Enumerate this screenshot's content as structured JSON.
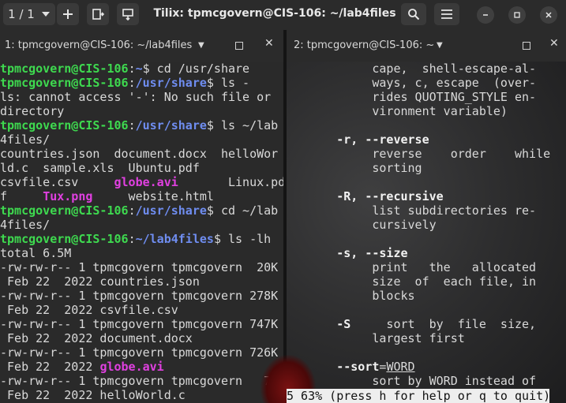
{
  "window": {
    "title": "Tilix: tpmcgovern@CIS-106: ~/lab4files",
    "session_counter": "1 / 1"
  },
  "icons": [
    "chevron-down-icon",
    "plus-icon",
    "split-right-icon",
    "split-down-icon",
    "search-icon",
    "hamburger-menu-icon",
    "minimize-icon",
    "maximize-icon",
    "close-icon"
  ],
  "left_pane": {
    "title": "1: tpmcgovern@CIS-106: ~/lab4files",
    "lines": [
      [
        {
          "t": "tpmcgovern@CIS-106",
          "c": "g"
        },
        {
          "t": ":",
          "c": ""
        },
        {
          "t": "~",
          "c": "b"
        },
        {
          "t": "$ cd /usr/share",
          "c": ""
        }
      ],
      [
        {
          "t": "tpmcgovern@CIS-106",
          "c": "g"
        },
        {
          "t": ":",
          "c": ""
        },
        {
          "t": "/usr/share",
          "c": "b"
        },
        {
          "t": "$ ls -",
          "c": ""
        }
      ],
      [
        {
          "t": "ls: cannot access '-': No such file or",
          "c": ""
        }
      ],
      [
        {
          "t": "directory",
          "c": ""
        }
      ],
      [
        {
          "t": "tpmcgovern@CIS-106",
          "c": "g"
        },
        {
          "t": ":",
          "c": ""
        },
        {
          "t": "/usr/share",
          "c": "b"
        },
        {
          "t": "$ ls ~/lab",
          "c": ""
        }
      ],
      [
        {
          "t": "4files/",
          "c": ""
        }
      ],
      [
        {
          "t": "countries.json  document.docx  helloWor",
          "c": ""
        }
      ],
      [
        {
          "t": "ld.c  sample.xls  Ubuntu.pdf",
          "c": ""
        }
      ],
      [
        {
          "t": "csvfile.csv     ",
          "c": ""
        },
        {
          "t": "globe.avi",
          "c": "m"
        },
        {
          "t": "       Linux.pd",
          "c": ""
        }
      ],
      [
        {
          "t": "f     ",
          "c": ""
        },
        {
          "t": "Tux.png",
          "c": "m"
        },
        {
          "t": "     website.html",
          "c": ""
        }
      ],
      [
        {
          "t": "tpmcgovern@CIS-106",
          "c": "g"
        },
        {
          "t": ":",
          "c": ""
        },
        {
          "t": "/usr/share",
          "c": "b"
        },
        {
          "t": "$ cd ~/lab",
          "c": ""
        }
      ],
      [
        {
          "t": "4files/",
          "c": ""
        }
      ],
      [
        {
          "t": "tpmcgovern@CIS-106",
          "c": "g"
        },
        {
          "t": ":",
          "c": ""
        },
        {
          "t": "~/lab4files",
          "c": "b"
        },
        {
          "t": "$ ls -lh",
          "c": ""
        }
      ],
      [
        {
          "t": "total 6.5M",
          "c": ""
        }
      ],
      [
        {
          "t": "-rw-rw-r-- 1 tpmcgovern tpmcgovern  20K",
          "c": ""
        }
      ],
      [
        {
          "t": " Feb 22  2022 countries.json",
          "c": ""
        }
      ],
      [
        {
          "t": "-rw-rw-r-- 1 tpmcgovern tpmcgovern 278K",
          "c": ""
        }
      ],
      [
        {
          "t": " Feb 22  2022 csvfile.csv",
          "c": ""
        }
      ],
      [
        {
          "t": "-rw-rw-r-- 1 tpmcgovern tpmcgovern 747K",
          "c": ""
        }
      ],
      [
        {
          "t": " Feb 22  2022 document.docx",
          "c": ""
        }
      ],
      [
        {
          "t": "-rw-rw-r-- 1 tpmcgovern tpmcgovern 726K",
          "c": ""
        }
      ],
      [
        {
          "t": " Feb 22  2022 ",
          "c": ""
        },
        {
          "t": "globe.avi",
          "c": "m"
        }
      ],
      [
        {
          "t": "-rw-rw-r-- 1 tpmcgovern tpmcgovern   76",
          "c": ""
        }
      ],
      [
        {
          "t": " Feb 22  2022 helloWorld.c",
          "c": ""
        }
      ]
    ]
  },
  "right_pane": {
    "title": "2: tpmcgovern@CIS-106: ~",
    "lines": [
      [
        {
          "t": "            cape,  shell-escape-al-",
          "c": ""
        }
      ],
      [
        {
          "t": "            ways, c, escape  (over-",
          "c": ""
        }
      ],
      [
        {
          "t": "            rides QUOTING_STYLE en-",
          "c": ""
        }
      ],
      [
        {
          "t": "            vironment variable)",
          "c": ""
        }
      ],
      [
        {
          "t": "",
          "c": ""
        }
      ],
      [
        {
          "t": "       ",
          "c": ""
        },
        {
          "t": "-r, --reverse",
          "c": "w"
        }
      ],
      [
        {
          "t": "            reverse    order    while",
          "c": ""
        }
      ],
      [
        {
          "t": "            sorting",
          "c": ""
        }
      ],
      [
        {
          "t": "",
          "c": ""
        }
      ],
      [
        {
          "t": "       ",
          "c": ""
        },
        {
          "t": "-R, --recursive",
          "c": "w"
        }
      ],
      [
        {
          "t": "            list subdirectories re-",
          "c": ""
        }
      ],
      [
        {
          "t": "            cursively",
          "c": ""
        }
      ],
      [
        {
          "t": "",
          "c": ""
        }
      ],
      [
        {
          "t": "       ",
          "c": ""
        },
        {
          "t": "-s, --size",
          "c": "w"
        }
      ],
      [
        {
          "t": "            print   the   allocated",
          "c": ""
        }
      ],
      [
        {
          "t": "            size  of  each file, in",
          "c": ""
        }
      ],
      [
        {
          "t": "            blocks",
          "c": ""
        }
      ],
      [
        {
          "t": "",
          "c": ""
        }
      ],
      [
        {
          "t": "       ",
          "c": ""
        },
        {
          "t": "-S",
          "c": "w"
        },
        {
          "t": "     sort  by  file  size,",
          "c": ""
        }
      ],
      [
        {
          "t": "            largest first",
          "c": ""
        }
      ],
      [
        {
          "t": "",
          "c": ""
        }
      ],
      [
        {
          "t": "       ",
          "c": ""
        },
        {
          "t": "--sort",
          "c": "w"
        },
        {
          "t": "=",
          "c": ""
        },
        {
          "t": "WORD",
          "c": "u"
        }
      ],
      [
        {
          "t": "            sort by WORD instead of",
          "c": ""
        }
      ]
    ],
    "status": "5 63% (press h for help or q to quit)"
  },
  "colors": {
    "prompt_user": "#3ed94f",
    "prompt_path": "#6f8df0",
    "media_file": "#e040e0",
    "terminal_bg": "#2a2a2a",
    "header_bg": "#2b2b2b"
  }
}
